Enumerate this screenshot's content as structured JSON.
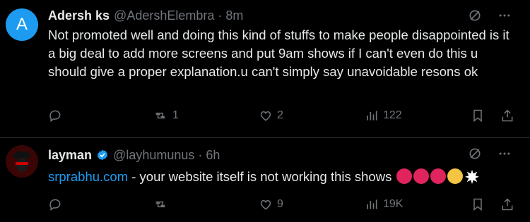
{
  "tweets": [
    {
      "avatar_letter": "A",
      "name": "Adersh ks",
      "handle": "@AdershElembra",
      "separator": "·",
      "time": "8m",
      "text": "Not promoted well and doing this kind of stuffs to make people disappointed is it a big deal to add more screens and put 9am shows if I can't even do this u should give a proper explanation.u can't simply say unavoidable resons ok",
      "replies": "",
      "reposts": "1",
      "likes": "2",
      "views": "122",
      "icons": [
        "grok-icon",
        "more-icon",
        "reply-icon",
        "repost-icon",
        "like-icon",
        "views-icon",
        "bookmark-icon",
        "share-icon"
      ]
    },
    {
      "name": "layman",
      "handle": "@layhumunus",
      "separator": "·",
      "time": "6h",
      "link_text": "srprabhu.com",
      "text": " - your website itself is not working this shows",
      "replies": "",
      "reposts": "",
      "likes": "9",
      "views": "19K",
      "emojis": [
        "angry-face",
        "angry-face",
        "angry-face",
        "steam-face",
        "anger-symbol"
      ],
      "icons": [
        "verified-icon",
        "grok-icon",
        "more-icon",
        "reply-icon",
        "repost-icon",
        "like-icon",
        "views-icon",
        "bookmark-icon",
        "share-icon"
      ]
    }
  ],
  "colors": {
    "background": "#000000",
    "text": "#e7e9ea",
    "muted": "#71767b",
    "link": "#1d9bf0",
    "verified": "#1d9bf0",
    "divider": "#2f3336"
  }
}
